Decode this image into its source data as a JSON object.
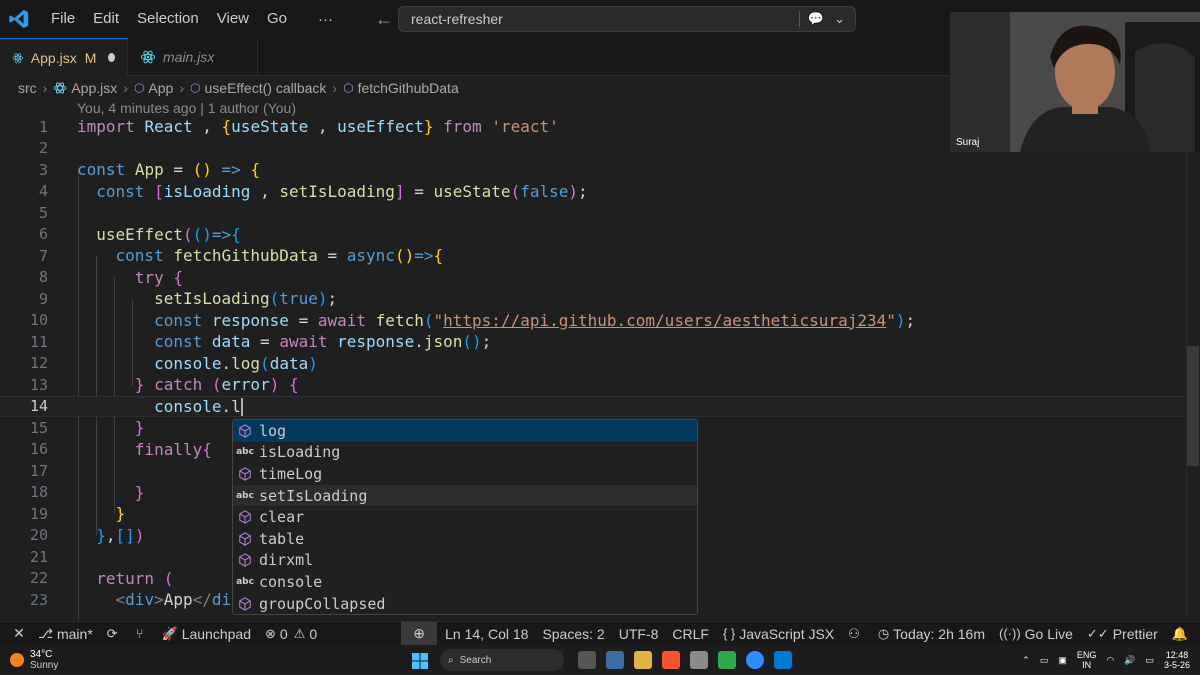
{
  "menu": [
    "File",
    "Edit",
    "Selection",
    "View",
    "Go"
  ],
  "menu_more": "···",
  "search": {
    "text": "react-refresher"
  },
  "tabs": [
    {
      "label": "App.jsx",
      "status": "M"
    },
    {
      "label": "main.jsx"
    }
  ],
  "breadcrumb": [
    "src",
    "App.jsx",
    "App",
    "useEffect() callback",
    "fetchGithubData"
  ],
  "blame": "You, 4 minutes ago | 1 author (You)",
  "webcam": {
    "name": "Suraj"
  },
  "suggestions": [
    {
      "label": "log",
      "kind": "method"
    },
    {
      "label": "isLoading",
      "kind": "abc"
    },
    {
      "label": "timeLog",
      "kind": "method"
    },
    {
      "label": "setIsLoading",
      "kind": "abc"
    },
    {
      "label": "clear",
      "kind": "method"
    },
    {
      "label": "table",
      "kind": "method"
    },
    {
      "label": "dirxml",
      "kind": "method"
    },
    {
      "label": "console",
      "kind": "abc"
    },
    {
      "label": "groupCollapsed",
      "kind": "method"
    }
  ],
  "status": {
    "branch": "main*",
    "launchpad": "Launchpad",
    "errors": "0",
    "warnings": "0",
    "position": "Ln 14, Col 18",
    "spaces": "Spaces: 2",
    "encoding": "UTF-8",
    "eol": "CRLF",
    "language": "JavaScript JSX",
    "today": "Today: 2h 16m",
    "golive": "Go Live",
    "prettier": "Prettier"
  },
  "taskbar": {
    "temp": "34°C",
    "weather": "Sunny",
    "search": "Search",
    "lang1": "ENG",
    "lang2": "IN",
    "time": "12:48",
    "date": "3-5-26"
  },
  "colors": {
    "accent": "#0078d4",
    "modified": "#e2c08d"
  }
}
